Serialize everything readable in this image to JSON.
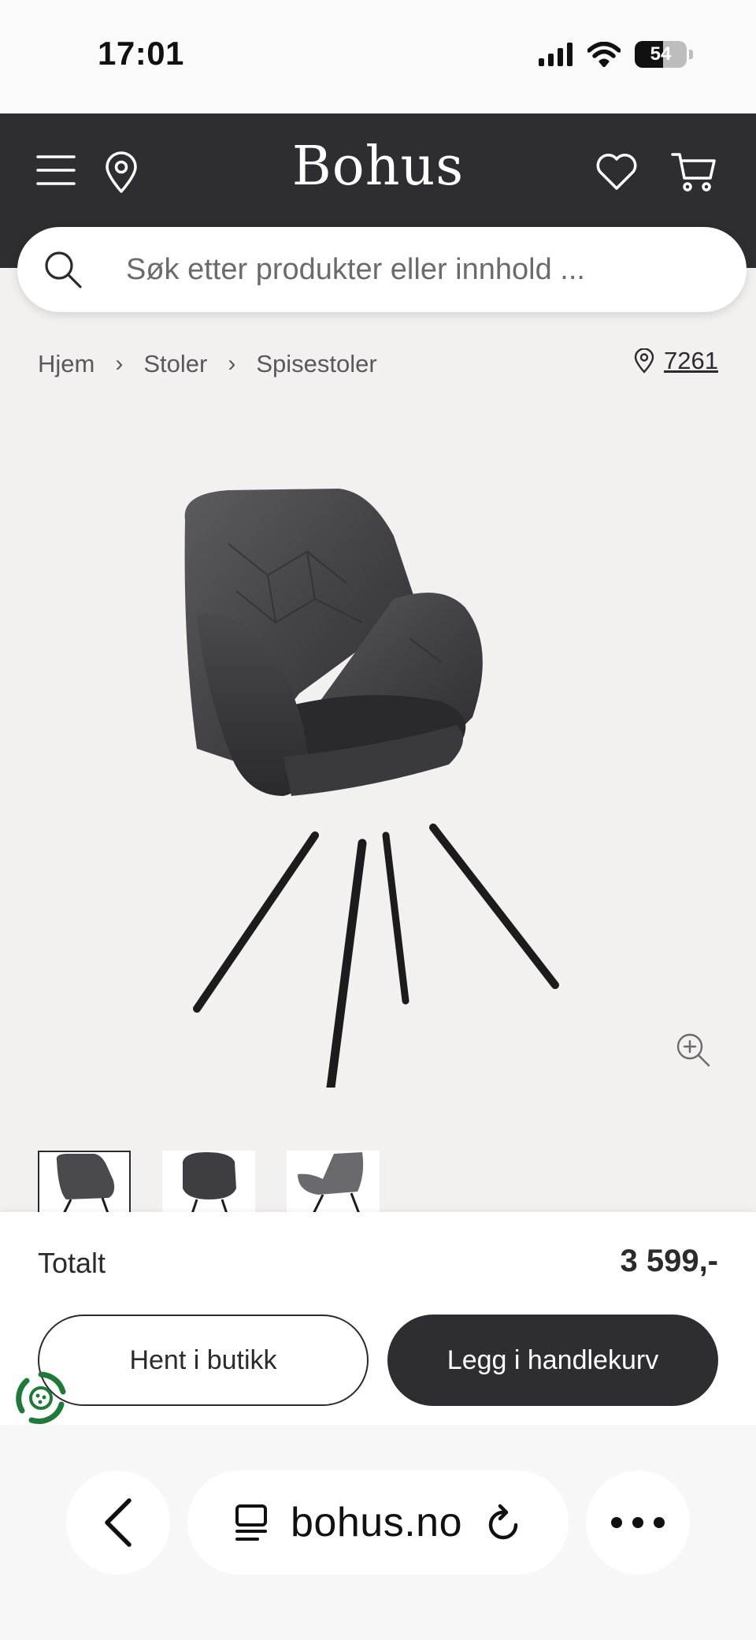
{
  "status_bar": {
    "time": "17:01",
    "battery_level": "54",
    "battery_fraction": 0.54
  },
  "header": {
    "logo": "Bohus"
  },
  "search": {
    "placeholder": "Søk etter produkter eller innhold ..."
  },
  "breadcrumb": {
    "items": [
      "Hjem",
      "Stoler",
      "Spisestoler"
    ]
  },
  "store": {
    "number": "7261"
  },
  "product": {
    "image_icon": "dining-chair-image",
    "thumbnails_count_visible": 3
  },
  "buy": {
    "total_label": "Totalt",
    "total_value": "3 599,-",
    "pickup_button": "Hent i butikk",
    "cart_button": "Legg i handlekurv"
  },
  "browser": {
    "url": "bohus.no"
  },
  "colors": {
    "header_bg": "#2e2d31",
    "page_bg": "#f2f1ef",
    "primary_button": "#2e2d31",
    "eco_green": "#1f7a3a"
  }
}
